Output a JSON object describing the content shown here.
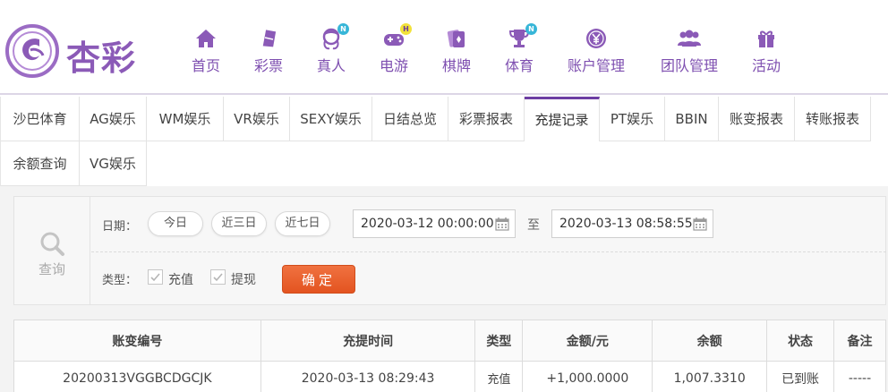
{
  "header": {
    "logo_text": "杏彩",
    "nav": [
      {
        "label": "首页",
        "icon": "home-icon"
      },
      {
        "label": "彩票",
        "icon": "lottery-ticket-icon"
      },
      {
        "label": "真人",
        "icon": "live-dealer-icon",
        "badge": "N"
      },
      {
        "label": "电游",
        "icon": "gamepad-icon",
        "badge": "H"
      },
      {
        "label": "棋牌",
        "icon": "cards-icon"
      },
      {
        "label": "体育",
        "icon": "trophy-icon",
        "badge": "N"
      },
      {
        "label": "账户管理",
        "icon": "yen-coin-icon"
      },
      {
        "label": "团队管理",
        "icon": "team-icon"
      },
      {
        "label": "活动",
        "icon": "gift-icon"
      }
    ]
  },
  "tabs": [
    {
      "label": "沙巴体育"
    },
    {
      "label": "AG娱乐"
    },
    {
      "label": "WM娱乐"
    },
    {
      "label": "VR娱乐"
    },
    {
      "label": "SEXY娱乐"
    },
    {
      "label": "日结总览"
    },
    {
      "label": "彩票报表"
    },
    {
      "label": "充提记录",
      "active": true
    },
    {
      "label": "PT娱乐"
    },
    {
      "label": "BBIN"
    },
    {
      "label": "账变报表"
    },
    {
      "label": "转账报表"
    },
    {
      "label": "余额查询"
    },
    {
      "label": "VG娱乐"
    }
  ],
  "filter": {
    "query_label": "查询",
    "date_label": "日期：",
    "quick_dates": [
      "今日",
      "近三日",
      "近七日"
    ],
    "start_date": "2020-03-12 00:00:00",
    "to_label": "至",
    "end_date": "2020-03-13 08:58:55",
    "type_label": "类型：",
    "types": [
      "充值",
      "提现"
    ],
    "confirm_label": "确定"
  },
  "table": {
    "headers": [
      "账变编号",
      "充提时间",
      "类型",
      "金额/元",
      "余额",
      "状态",
      "备注"
    ],
    "rows": [
      {
        "id": "20200313VGGBCDGCJK",
        "time": "2020-03-13 08:29:43",
        "type": "充值",
        "amount": "+1,000.0000",
        "balance": "1,007.3310",
        "status": "已到账",
        "note": "-----"
      }
    ]
  },
  "colors": {
    "brand": "#8b5ab7",
    "nav_text": "#7e4fb0",
    "confirm": "#ec5f2a",
    "amount": "#d02525",
    "status_ok": "#2f9e2f"
  }
}
